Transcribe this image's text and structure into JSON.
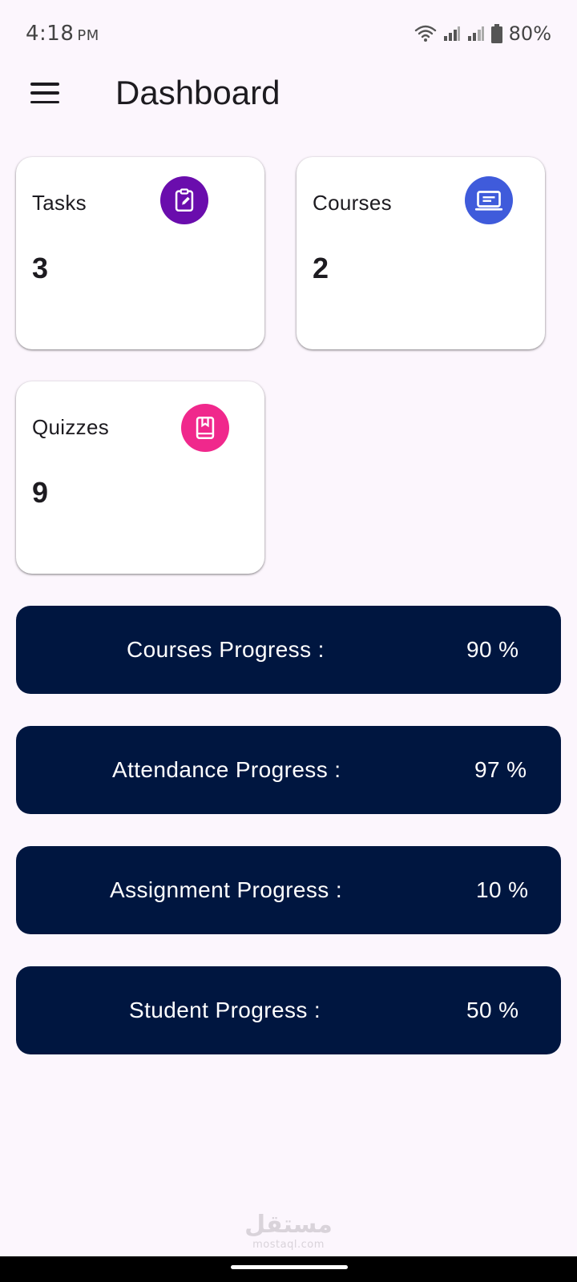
{
  "status_bar": {
    "time": "4:18",
    "ampm": "PM",
    "battery": "80%"
  },
  "header": {
    "title": "Dashboard"
  },
  "cards": {
    "tasks": {
      "label": "Tasks",
      "value": "3",
      "icon": "clipboard-edit-icon",
      "color": "#6a0dad"
    },
    "courses": {
      "label": "Courses",
      "value": "2",
      "icon": "laptop-icon",
      "color": "#3f5bdb"
    },
    "quizzes": {
      "label": "Quizzes",
      "value": "9",
      "icon": "book-bookmark-icon",
      "color": "#f0288c"
    }
  },
  "progress": {
    "bar_color": "#001640",
    "items": [
      {
        "label": "Courses Progress :",
        "value": "90 %"
      },
      {
        "label": "Attendance Progress :",
        "value": "97 %"
      },
      {
        "label": "Assignment Progress :",
        "value": "10 %"
      },
      {
        "label": "Student Progress :",
        "value": "50 %"
      }
    ]
  },
  "watermark": {
    "logo": "مستقل",
    "text": "mostaql.com"
  }
}
